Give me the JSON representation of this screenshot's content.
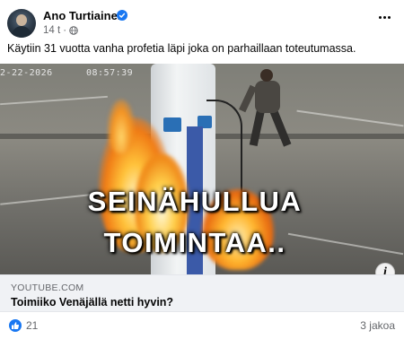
{
  "post": {
    "author": "Ano Turtiainen",
    "time": "14 t",
    "separator": "·",
    "text": "Käytiin 31 vuotta vanha profetia läpi joka on parhaillaan toteutumassa.",
    "more_icon": "more-options-icon",
    "privacy_icon": "globe-icon"
  },
  "preview": {
    "cctv_date": "2-22-2026 ",
    "cctv_time": "08:57:39",
    "overlay_line1": "SEINÄHULLUA",
    "overlay_line2": "TOIMINTAA..",
    "info_label": "i",
    "domain": "YOUTUBE.COM",
    "title": "Toimiiko Venäjällä netti hyvin?"
  },
  "footer": {
    "reaction_icon": "like-icon",
    "reaction_count": "21",
    "shares": "3 jakoa"
  },
  "colors": {
    "accent": "#1877f2",
    "secondary_text": "#65676b",
    "link_bar": "#f0f2f5"
  }
}
